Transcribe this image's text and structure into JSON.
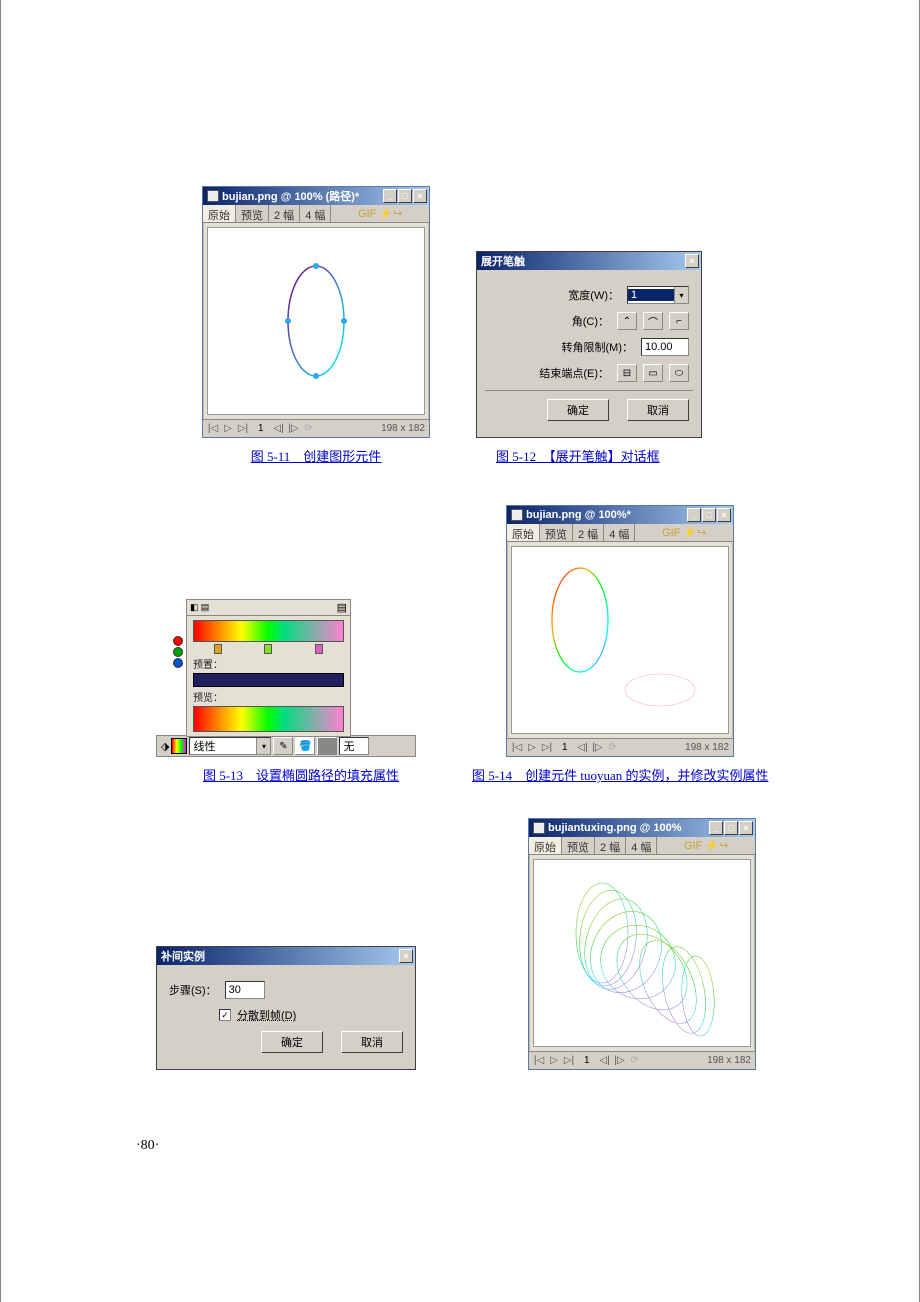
{
  "page_number": "·80·",
  "captions": {
    "c11": "图 5-11　创建图形元件",
    "c12": "图 5-12　【展开笔触】对话框",
    "c13": "图 5-13　设置椭圆路径的填充属性",
    "c14": "图 5-14　创建元件 tuoyuan 的实例，并修改实例属性"
  },
  "doc_win": {
    "title_a": "bujian.png @ 100% (路径)*",
    "title_b": "bujian.png @ 100%*",
    "title_c": "bujiantuxing.png @ 100%",
    "tabs": {
      "original": "原始",
      "preview": "预览",
      "two": "2 幅",
      "four": "4 幅",
      "gif": "GIF"
    },
    "status": {
      "frame": "1",
      "dim": "198 x 182"
    }
  },
  "expand_stroke": {
    "title": "展开笔触",
    "width_label": "宽度(W)：",
    "width_value": "1",
    "corner_label": "角(C)：",
    "miter_label": "转角限制(M)：",
    "miter_value": "10.00",
    "endcap_label": "结束端点(E)：",
    "ok": "确定",
    "cancel": "取消"
  },
  "gradient": {
    "preset_label": "预置：",
    "preview_label": "预览：",
    "dropdown": "线性",
    "none": "无"
  },
  "tween": {
    "title": "补间实例",
    "steps_label": "步骤(S)：",
    "steps_value": "30",
    "checkbox": "分散到帧(D)",
    "ok": "确定",
    "cancel": "取消"
  }
}
